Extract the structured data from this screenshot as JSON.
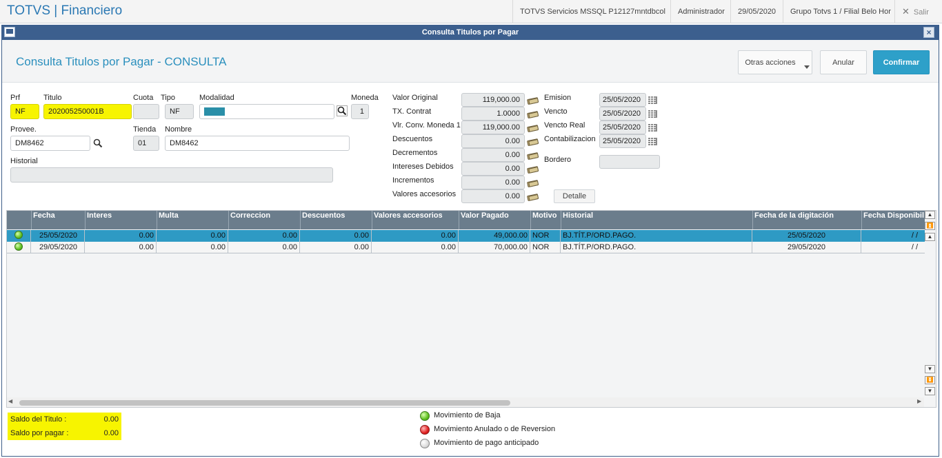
{
  "app": {
    "title": "TOTVS | Financiero",
    "server": "TOTVS Servicios MSSQL P12127mntdbcol",
    "user": "Administrador",
    "date": "29/05/2020",
    "branch": "Grupo Totvs 1 / Filial Belo Hor",
    "exit_label": "Salir"
  },
  "dialog": {
    "window_title": "Consulta Titulos por Pagar",
    "page_title": "Consulta Titulos por Pagar - CONSULTA",
    "more_actions": "Otras acciones",
    "cancel": "Anular",
    "confirm": "Confirmar"
  },
  "form": {
    "prf_label": "Prf",
    "prf": "NF",
    "titulo_label": "Titulo",
    "titulo": "202005250001B",
    "cuota_label": "Cuota",
    "cuota": "",
    "tipo_label": "Tipo",
    "tipo": "NF",
    "modalidad_label": "Modalidad",
    "modalidad": "",
    "moneda_label": "Moneda",
    "moneda": "1",
    "provee_label": "Provee.",
    "provee": "DM8462",
    "tienda_label": "Tienda",
    "tienda": "01",
    "nombre_label": "Nombre",
    "nombre": "DM8462",
    "historial_label": "Historial",
    "historial": ""
  },
  "values": [
    {
      "label": "Valor Original",
      "value": "119,000.00"
    },
    {
      "label": "TX. Contrat",
      "value": "1.0000"
    },
    {
      "label": "Vlr. Conv. Moneda 1",
      "value": "119,000.00"
    },
    {
      "label": "Descuentos",
      "value": "0.00"
    },
    {
      "label": "Decrementos",
      "value": "0.00"
    },
    {
      "label": "Intereses Debidos",
      "value": "0.00"
    },
    {
      "label": "Incrementos",
      "value": "0.00"
    },
    {
      "label": "Valores accesorios",
      "value": "0.00"
    }
  ],
  "dates": [
    {
      "label": "Emision",
      "value": "25/05/2020"
    },
    {
      "label": "Vencto",
      "value": "25/05/2020"
    },
    {
      "label": "Vencto Real",
      "value": "25/05/2020"
    },
    {
      "label": "Contabilizacion",
      "value": "25/05/2020"
    }
  ],
  "bordero_label": "Bordero",
  "bordero": "",
  "detalle_label": "Detalle",
  "grid": {
    "columns": [
      "",
      "Fecha",
      "Interes",
      "Multa",
      "Correccion",
      "Descuentos",
      "Valores accesorios",
      "Valor Pagado",
      "Motivo",
      "Historial",
      "Fecha de la digitación",
      "Fecha Disponibil"
    ],
    "rows": [
      {
        "status": "green",
        "fecha": "25/05/2020",
        "interes": "0.00",
        "multa": "0.00",
        "correccion": "0.00",
        "descuentos": "0.00",
        "accesorios": "0.00",
        "pagado": "49,000.00",
        "motivo": "NOR",
        "historial": "BJ.TÍT.P/ORD.PAGO.",
        "digitacion": "25/05/2020",
        "disponib": "/  /"
      },
      {
        "status": "green",
        "fecha": "29/05/2020",
        "interes": "0.00",
        "multa": "0.00",
        "correccion": "0.00",
        "descuentos": "0.00",
        "accesorios": "0.00",
        "pagado": "70,000.00",
        "motivo": "NOR",
        "historial": "BJ.TÍT.P/ORD.PAGO.",
        "digitacion": "29/05/2020",
        "disponib": "/  /"
      }
    ]
  },
  "footer": {
    "saldo_titulo_label": "Saldo del Titulo :",
    "saldo_titulo": "0.00",
    "saldo_pagar_label": "Saldo por pagar  :",
    "saldo_pagar": "0.00",
    "legend": [
      {
        "color": "green",
        "label": "Movimiento de Baja"
      },
      {
        "color": "red",
        "label": "Movimiento Anulado o de Reversion"
      },
      {
        "color": "gray",
        "label": "Movimiento de pago anticipado"
      }
    ]
  },
  "colors": {
    "accent": "#2ea0c9",
    "title_bar": "#3c5f8e",
    "highlight": "#f7f400",
    "grid_header": "#6b7d8c",
    "selected_row": "#2e9ac4"
  }
}
